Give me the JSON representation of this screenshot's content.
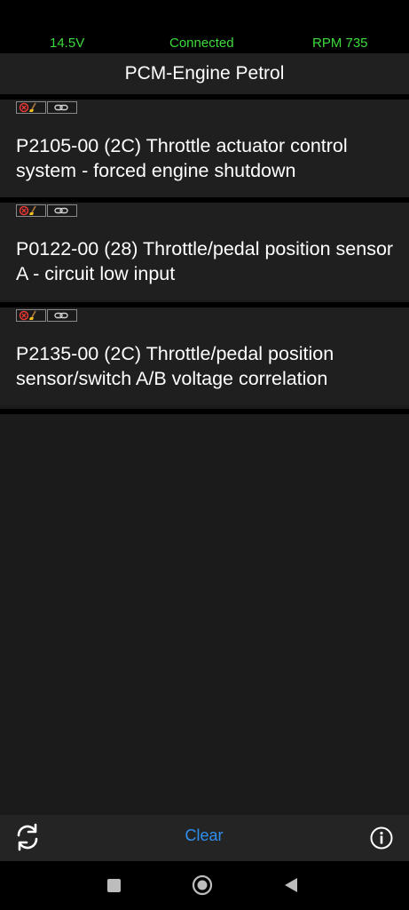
{
  "status": {
    "voltage": "14.5V",
    "connection": "Connected",
    "rpm": "RPM 735"
  },
  "header": {
    "title": "PCM-Engine Petrol"
  },
  "dtcs": [
    {
      "text": "P2105-00 (2C) Throttle actuator control system - forced engine shutdown",
      "icons": [
        "clear-error-icon",
        "link-icon"
      ]
    },
    {
      "text": "P0122-00 (28) Throttle/pedal position sensor A - circuit low input",
      "icons": [
        "clear-error-icon",
        "link-icon"
      ]
    },
    {
      "text": "P2135-00 (2C) Throttle/pedal position sensor/switch A/B voltage correlation",
      "icons": [
        "clear-error-icon",
        "link-icon"
      ]
    }
  ],
  "toolbar": {
    "clear_label": "Clear",
    "left_icon": "refresh-icon",
    "right_icon": "info-icon"
  },
  "nav": {
    "icons": [
      "recents-icon",
      "home-icon",
      "back-icon"
    ]
  },
  "colors": {
    "status_green": "#3ddc3d",
    "accent_blue": "#2f8ff0",
    "background": "#1b1b1b"
  }
}
